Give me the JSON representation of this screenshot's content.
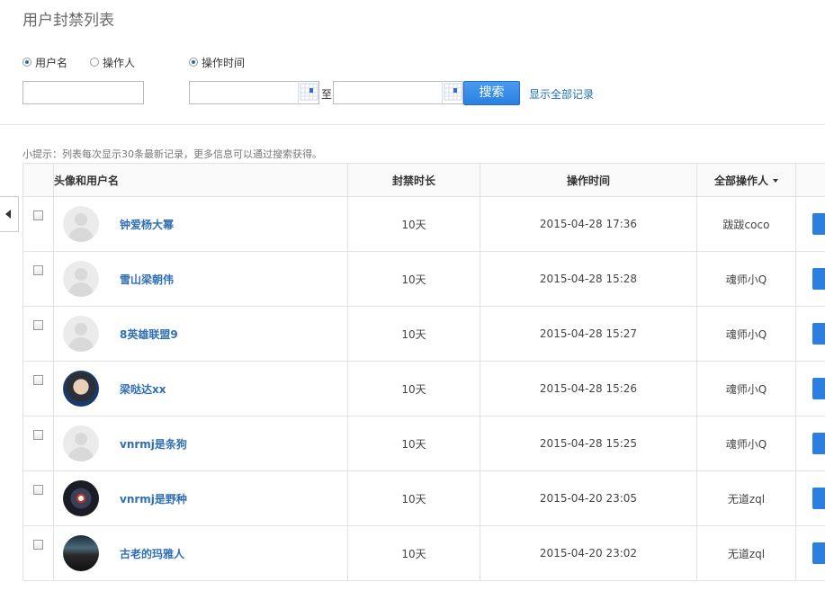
{
  "page_title": "用户封禁列表",
  "filters": {
    "radios": [
      {
        "label": "用户名",
        "checked": true
      },
      {
        "label": "操作人",
        "checked": false
      },
      {
        "label": "操作时间",
        "checked": true
      }
    ],
    "username_input": "",
    "date_from": "",
    "date_to": "",
    "to_label": "至",
    "search_label": "搜索",
    "show_all_label": "显示全部记录"
  },
  "tip": "小提示：列表每次显示30条最新记录，更多信息可以通过搜索获得。",
  "table": {
    "headers": {
      "user": "头像和用户名",
      "duration": "封禁时长",
      "time": "操作时间",
      "operator": "全部操作人"
    },
    "rows": [
      {
        "avatar": "default-avatar-icon",
        "username": "钟爱杨大幂",
        "duration": "10天",
        "time": "2015-04-28 17:36",
        "operator": "跋跋coco"
      },
      {
        "avatar": "default-avatar-icon",
        "username": "雪山梁朝伟",
        "duration": "10天",
        "time": "2015-04-28 15:28",
        "operator": "魂师小Q"
      },
      {
        "avatar": "default-avatar-icon",
        "username": "8英雄联盟9",
        "duration": "10天",
        "time": "2015-04-28 15:27",
        "operator": "魂师小Q"
      },
      {
        "avatar": "photo-avatar",
        "username": "梁哒达xx",
        "duration": "10天",
        "time": "2015-04-28 15:26",
        "operator": "魂师小Q"
      },
      {
        "avatar": "default-avatar-icon",
        "username": "vnrmj是条狗",
        "duration": "10天",
        "time": "2015-04-28 15:25",
        "operator": "魂师小Q"
      },
      {
        "avatar": "photo-avatar",
        "username": "vnrmj是野种",
        "duration": "10天",
        "time": "2015-04-20 23:05",
        "operator": "无道zql"
      },
      {
        "avatar": "photo-avatar",
        "username": "古老的玛雅人",
        "duration": "10天",
        "time": "2015-04-20 23:02",
        "operator": "无道zql"
      }
    ]
  },
  "colors": {
    "accent": "#2a7fe0",
    "link": "#1f6fb5",
    "username": "#2f6fb3"
  }
}
